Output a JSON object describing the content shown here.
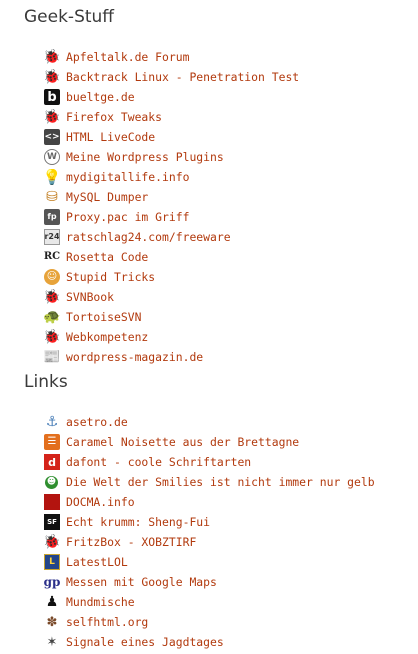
{
  "sections": [
    {
      "title": "Geek-Stuff",
      "items": [
        {
          "label": "Apfeltalk.de Forum",
          "icon": "bug-icon"
        },
        {
          "label": "Backtrack Linux - Penetration Test",
          "icon": "bug-icon"
        },
        {
          "label": "bueltge.de",
          "icon": "b-logo-icon"
        },
        {
          "label": "Firefox Tweaks",
          "icon": "bug-icon"
        },
        {
          "label": "HTML LiveCode",
          "icon": "code-icon"
        },
        {
          "label": "Meine Wordpress Plugins",
          "icon": "wordpress-icon"
        },
        {
          "label": "mydigitallife.info",
          "icon": "lightbulb-icon"
        },
        {
          "label": "MySQL Dumper",
          "icon": "database-icon"
        },
        {
          "label": "Proxy.pac im Griff",
          "icon": "fp-logo-icon"
        },
        {
          "label": "ratschlag24.com/freeware",
          "icon": "r24-logo-icon"
        },
        {
          "label": "Rosetta Code",
          "icon": "rosetta-code-icon"
        },
        {
          "label": "Stupid Tricks",
          "icon": "stupid-tricks-icon"
        },
        {
          "label": "SVNBook",
          "icon": "bug-icon"
        },
        {
          "label": "TortoiseSVN",
          "icon": "turtle-icon"
        },
        {
          "label": "Webkompetenz",
          "icon": "bug-icon"
        },
        {
          "label": "wordpress-magazin.de",
          "icon": "magazine-icon"
        }
      ]
    },
    {
      "title": "Links",
      "items": [
        {
          "label": "asetro.de",
          "icon": "anchor-icon"
        },
        {
          "label": "Caramel Noisette aus der Brettagne",
          "icon": "caramel-icon"
        },
        {
          "label": "dafont - coole Schriftarten",
          "icon": "dafont-icon"
        },
        {
          "label": "Die Welt der Smilies ist nicht immer nur gelb",
          "icon": "smiley-icon"
        },
        {
          "label": "DOCMA.info",
          "icon": "docma-icon"
        },
        {
          "label": "Echt krumm: Sheng-Fui",
          "icon": "sheng-fui-icon"
        },
        {
          "label": "FritzBox - XOBZTIRF",
          "icon": "bug-icon"
        },
        {
          "label": "LatestLOL",
          "icon": "latestlol-icon"
        },
        {
          "label": "Messen mit Google Maps",
          "icon": "gp-logo-icon"
        },
        {
          "label": "Mundmische",
          "icon": "person-icon"
        },
        {
          "label": "selfhtml.org",
          "icon": "selfhtml-icon"
        },
        {
          "label": "Signale eines Jagdtages",
          "icon": "hunter-icon"
        }
      ]
    }
  ],
  "colors": {
    "link": "#b23a0e",
    "heading": "#3a3a3a",
    "background": "#ffffff"
  }
}
